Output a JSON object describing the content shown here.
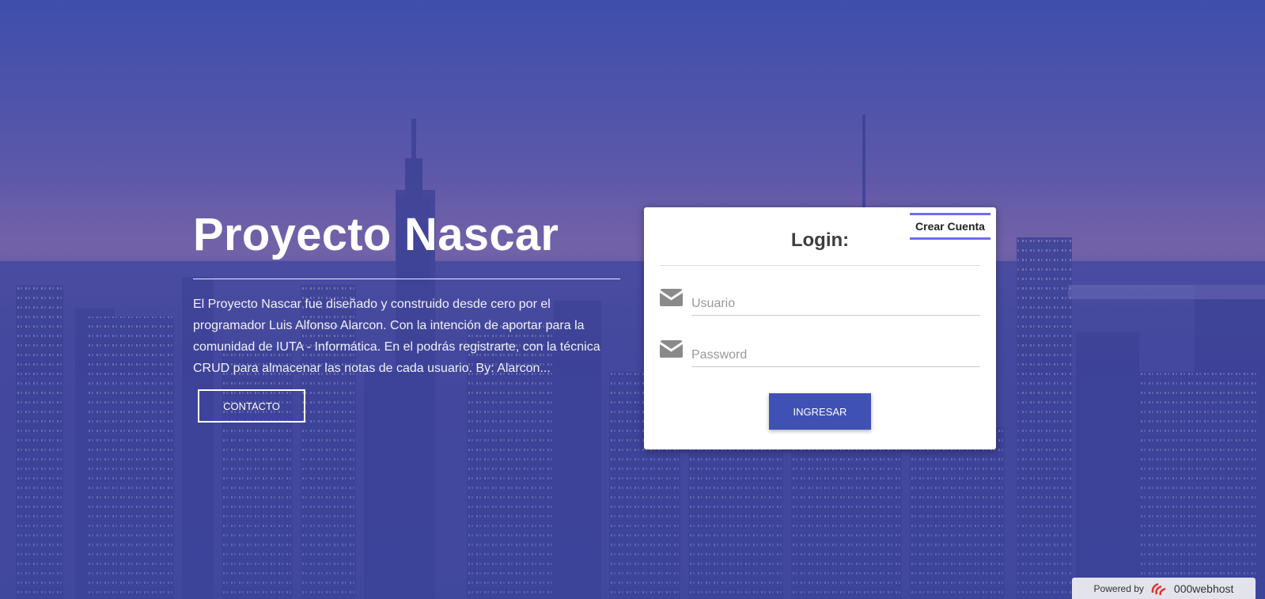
{
  "hero": {
    "title": "Proyecto Nascar",
    "description": "El Proyecto Nascar fue diseñado y construido desde cero por el programador Luis Alfonso Alarcon. Con la intención de aportar para la comunidad de IUTA - Informática. En el podrás registrarte, con la técnica CRUD para almacenar las notas de cada usuario. By: Alarcon...",
    "contact_label": "CONTACTO"
  },
  "login": {
    "create_account_label": "Crear Cuenta",
    "title": "Login:",
    "username_placeholder": "Usuario",
    "password_placeholder": "Password",
    "submit_label": "INGRESAR"
  },
  "footer": {
    "powered_by": "Powered by",
    "brand": "000webhost"
  },
  "colors": {
    "overlay": "#3f51b5",
    "accent": "#6c6ef0",
    "button": "#3f51b5"
  }
}
